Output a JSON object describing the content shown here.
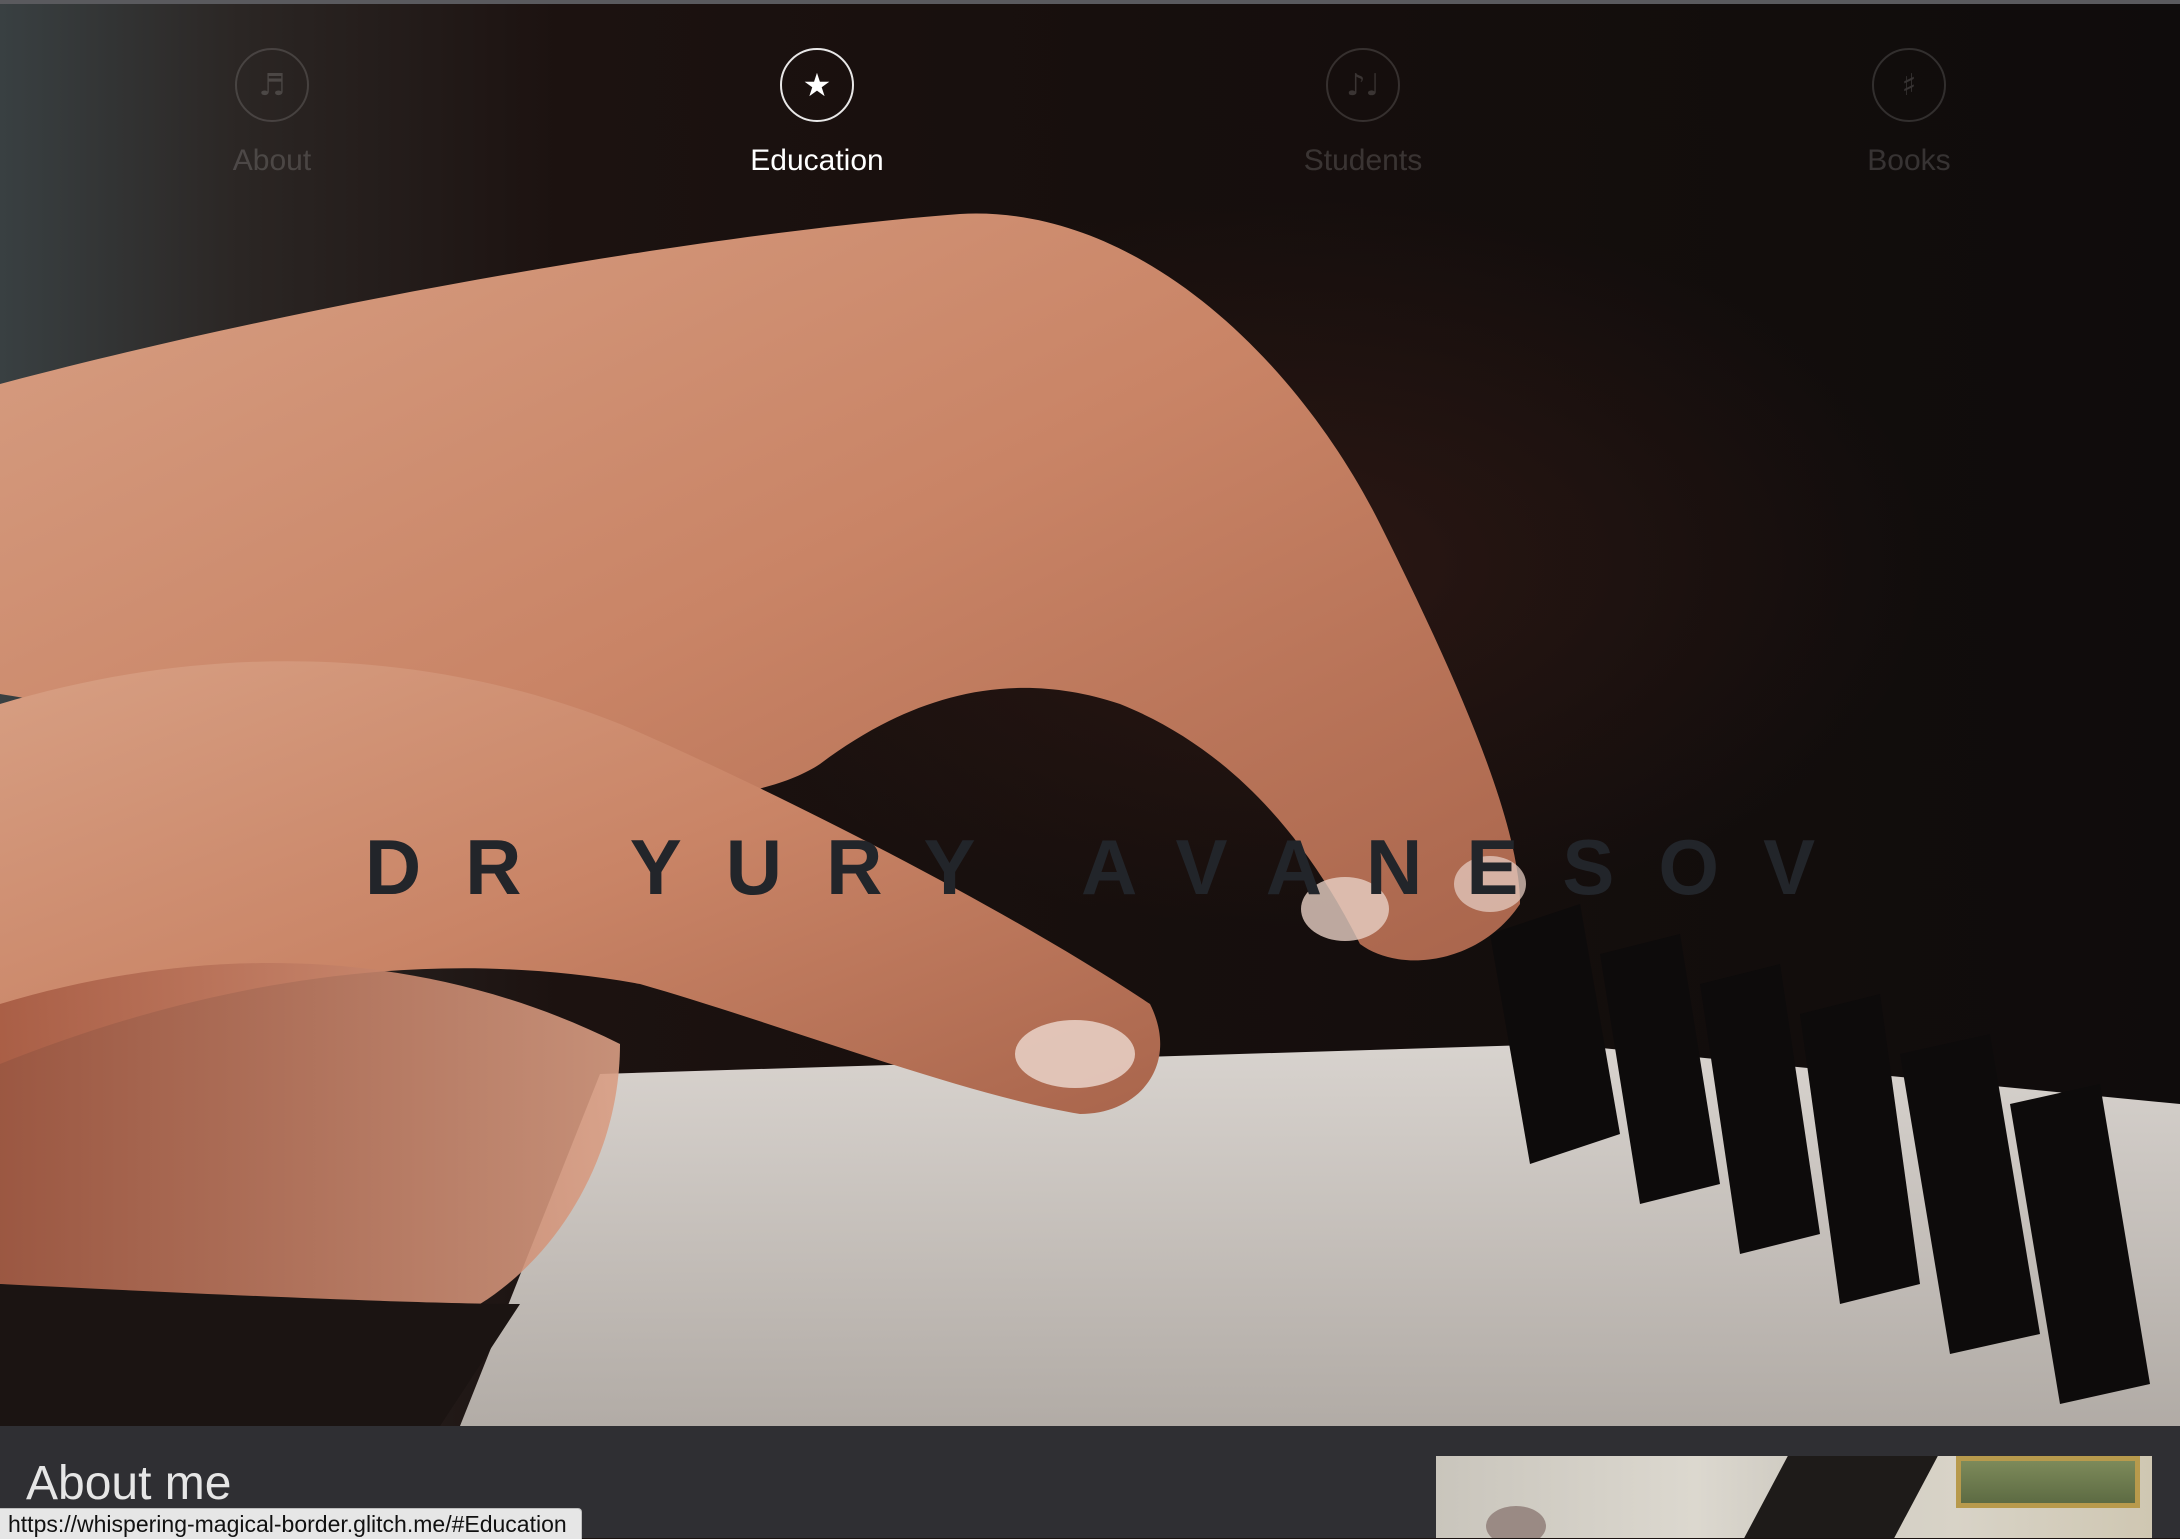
{
  "nav": {
    "items": [
      {
        "label": "About",
        "icon": "♬"
      },
      {
        "label": "Education",
        "icon": "★"
      },
      {
        "label": "Students",
        "icon": "♪♩"
      },
      {
        "label": "Books",
        "icon": "♯"
      }
    ],
    "active": "Education"
  },
  "hero": {
    "title": "DR YURY AVANESOV"
  },
  "about": {
    "heading": "About me"
  },
  "status_bar": {
    "url": "https://whispering-magical-border.glitch.me/#Education"
  },
  "colors": {
    "title_text": "#22252a",
    "nav_active": "#ffffff",
    "nav_inactive": "#3a3636",
    "section_bg": "#2f2f33",
    "hero_bg": "#170f0d"
  }
}
